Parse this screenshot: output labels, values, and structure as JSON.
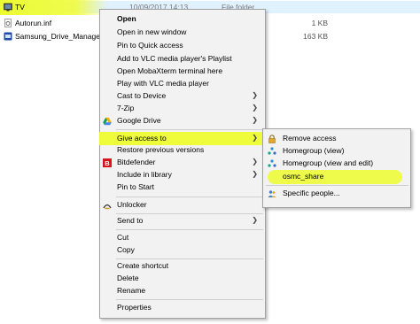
{
  "files": [
    {
      "name": "TV",
      "date": "10/09/2017 14:13",
      "type": "File folder",
      "size": ""
    },
    {
      "name": "Autorun.inf",
      "date": "",
      "type": "",
      "size": "1 KB"
    },
    {
      "name": "Samsung_Drive_Manager.exe",
      "date": "",
      "type": "",
      "size": "163 KB"
    }
  ],
  "context_menu": {
    "items": [
      {
        "label": "Open"
      },
      {
        "label": "Open in new window"
      },
      {
        "label": "Pin to Quick access"
      },
      {
        "label": "Add to VLC media player's Playlist"
      },
      {
        "label": "Open MobaXterm terminal here"
      },
      {
        "label": "Play with VLC media player"
      },
      {
        "label": "Cast to Device"
      },
      {
        "label": "7-Zip"
      },
      {
        "label": "Google Drive"
      },
      {
        "label": "Give access to"
      },
      {
        "label": "Restore previous versions"
      },
      {
        "label": "Bitdefender"
      },
      {
        "label": "Include in library"
      },
      {
        "label": "Pin to Start"
      },
      {
        "label": "Unlocker"
      },
      {
        "label": "Send to"
      },
      {
        "label": "Cut"
      },
      {
        "label": "Copy"
      },
      {
        "label": "Create shortcut"
      },
      {
        "label": "Delete"
      },
      {
        "label": "Rename"
      },
      {
        "label": "Properties"
      }
    ]
  },
  "submenu": {
    "items": [
      {
        "label": "Remove access"
      },
      {
        "label": "Homegroup (view)"
      },
      {
        "label": "Homegroup (view and edit)"
      },
      {
        "label": "osmc_share"
      },
      {
        "label": "Specific people..."
      }
    ]
  },
  "colors": {
    "highlight": "#eefc32",
    "menu_bg": "#f2f2f2",
    "folder": "#e8c04a"
  },
  "icons": {
    "remove_access": "lock-icon",
    "homegroup": "homegroup-icon",
    "specific_people": "people-icon",
    "google_drive": "google-drive-icon",
    "bitdefender": "bitdefender-icon",
    "unlocker": "unlocker-icon"
  }
}
